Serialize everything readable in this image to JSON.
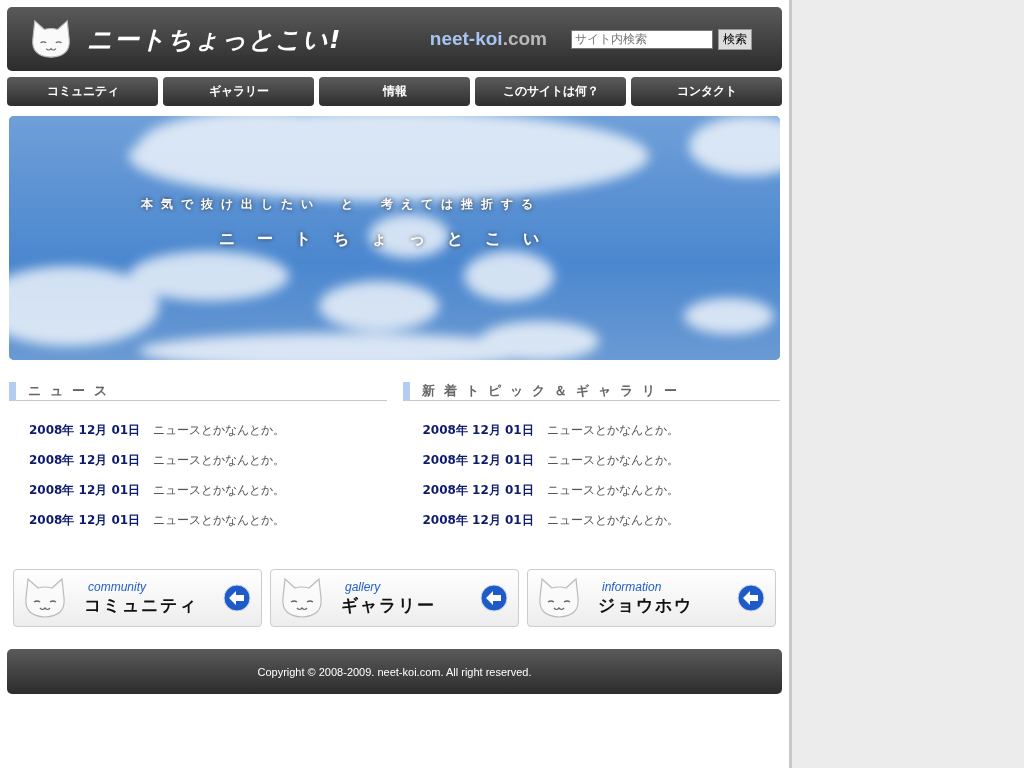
{
  "header": {
    "logo_text": "ニートちょっとこい!",
    "domain_name": "neet-koi",
    "domain_tld": ".com",
    "search": {
      "placeholder": "サイト内検索",
      "button": "検索"
    }
  },
  "nav": [
    {
      "label": "コミュニティ"
    },
    {
      "label": "ギャラリー"
    },
    {
      "label": "情報"
    },
    {
      "label": "このサイトは何？"
    },
    {
      "label": "コンタクト"
    }
  ],
  "banner": {
    "tagline": "本気で抜け出したい　と　考えては挫折する",
    "title": "ニートちょっとこい"
  },
  "sections": [
    {
      "heading": "ニュース",
      "items": [
        {
          "date": "2008年 12月 01日",
          "text": "ニュースとかなんとか。"
        },
        {
          "date": "2008年 12月 01日",
          "text": "ニュースとかなんとか。"
        },
        {
          "date": "2008年 12月 01日",
          "text": "ニュースとかなんとか。"
        },
        {
          "date": "2008年 12月 01日",
          "text": "ニュースとかなんとか。"
        }
      ]
    },
    {
      "heading": "新着トピック＆ギャラリー",
      "items": [
        {
          "date": "2008年 12月 01日",
          "text": "ニュースとかなんとか。"
        },
        {
          "date": "2008年 12月 01日",
          "text": "ニュースとかなんとか。"
        },
        {
          "date": "2008年 12月 01日",
          "text": "ニュースとかなんとか。"
        },
        {
          "date": "2008年 12月 01日",
          "text": "ニュースとかなんとか。"
        }
      ]
    }
  ],
  "link_cards": [
    {
      "subtitle": "community",
      "title": "コミュニティ"
    },
    {
      "subtitle": "gallery",
      "title": "ギャラリー"
    },
    {
      "subtitle": "information",
      "title": "ジョウホウ"
    }
  ],
  "footer": {
    "copyright": "Copyright © 2008-2009. neet-koi.com. All right reserved."
  }
}
